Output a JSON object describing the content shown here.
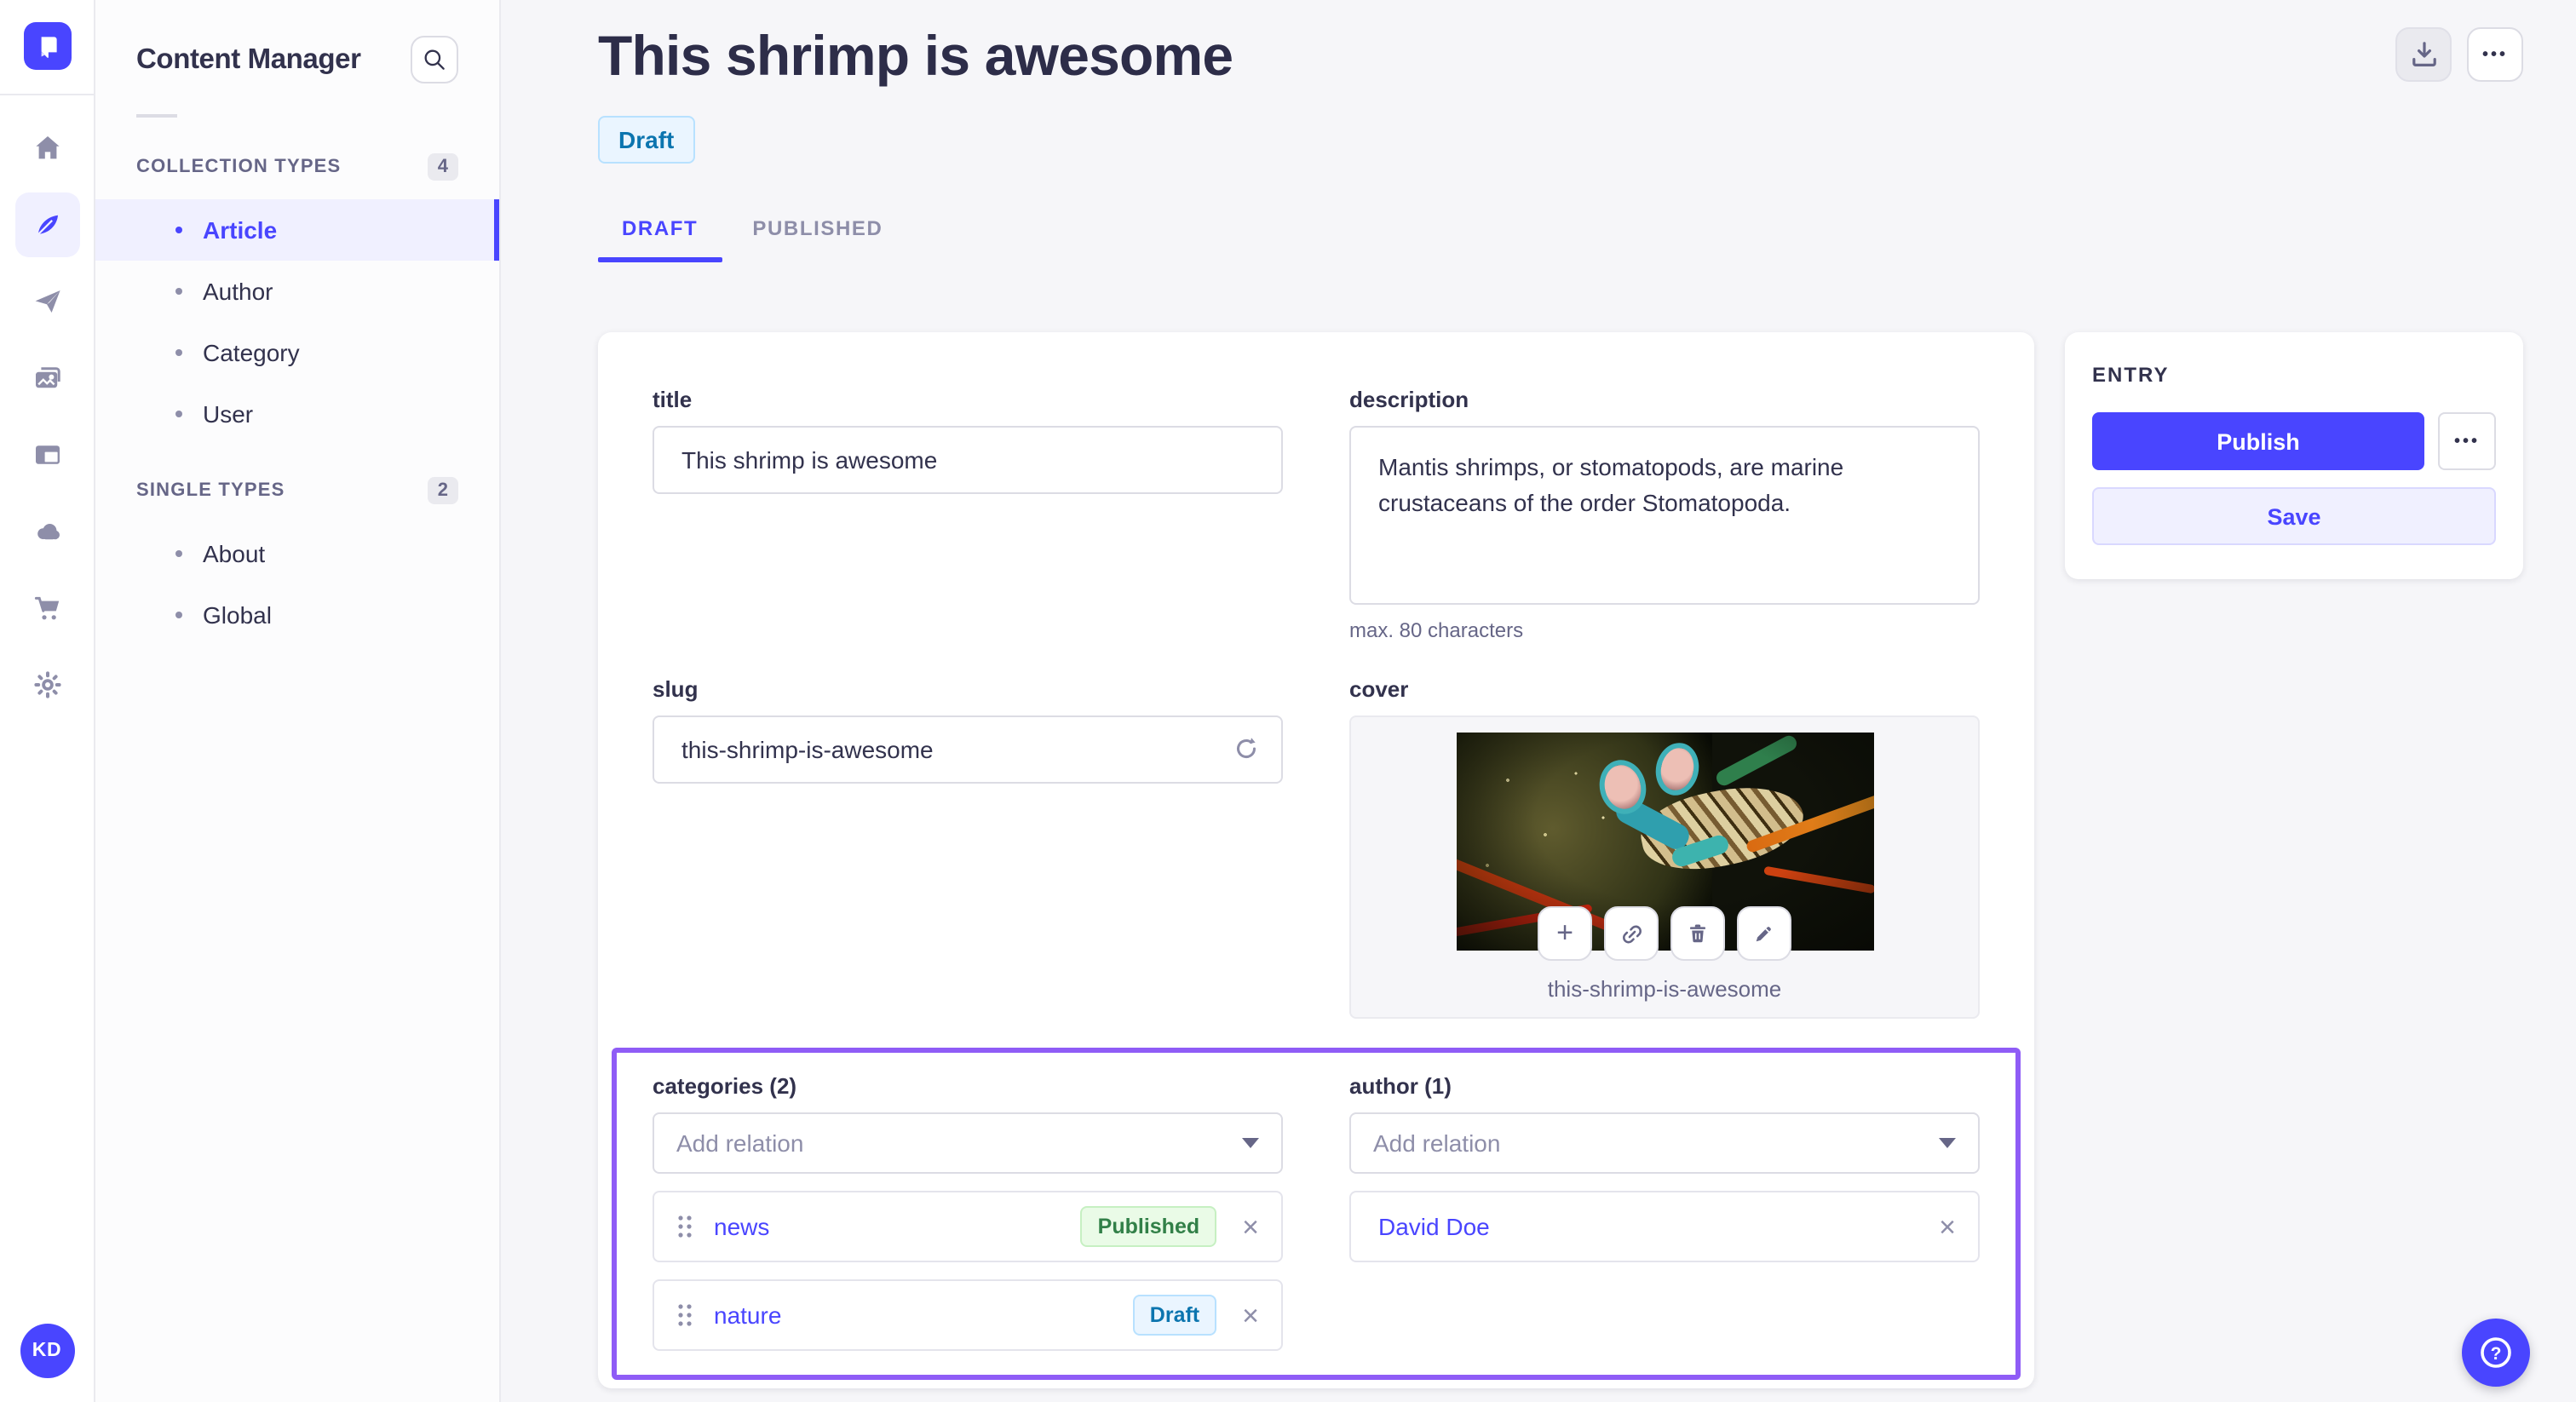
{
  "nav": {
    "avatar_initials": "KD",
    "rail_items": [
      "home",
      "content-manager",
      "releases",
      "media-library",
      "content-type-builder",
      "deploy-cloud",
      "marketplace",
      "settings"
    ],
    "active_rail_item": "content-manager"
  },
  "sidebar": {
    "title": "Content Manager",
    "search_icon": "search-icon",
    "sections": [
      {
        "label": "COLLECTION TYPES",
        "count": "4",
        "items": [
          {
            "label": "Article",
            "active": true
          },
          {
            "label": "Author",
            "active": false
          },
          {
            "label": "Category",
            "active": false
          },
          {
            "label": "User",
            "active": false
          }
        ]
      },
      {
        "label": "SINGLE TYPES",
        "count": "2",
        "items": [
          {
            "label": "About",
            "active": false
          },
          {
            "label": "Global",
            "active": false
          }
        ]
      }
    ]
  },
  "header": {
    "title": "This shrimp is awesome",
    "status_badge": "Draft",
    "actions": {
      "download_icon": "download-icon",
      "more_label": "•••"
    },
    "tabs": [
      {
        "label": "DRAFT",
        "active": true
      },
      {
        "label": "PUBLISHED",
        "active": false
      }
    ]
  },
  "form": {
    "title": {
      "label": "title",
      "value": "This shrimp is awesome"
    },
    "description": {
      "label": "description",
      "value": "Mantis shrimps, or stomatopods, are marine crustaceans of the order Stomatopoda.",
      "helper": "max. 80 characters"
    },
    "slug": {
      "label": "slug",
      "value": "this-shrimp-is-awesome",
      "regenerate_icon": "refresh-icon"
    },
    "cover": {
      "label": "cover",
      "caption": "this-shrimp-is-awesome",
      "action_icons": [
        "plus-icon",
        "link-icon",
        "trash-icon",
        "pencil-icon"
      ]
    },
    "categories": {
      "label": "categories (2)",
      "placeholder": "Add relation",
      "items": [
        {
          "name": "news",
          "status": "Published"
        },
        {
          "name": "nature",
          "status": "Draft"
        }
      ]
    },
    "author": {
      "label": "author (1)",
      "placeholder": "Add relation",
      "items": [
        {
          "name": "David Doe"
        }
      ]
    }
  },
  "entry_panel": {
    "title": "ENTRY",
    "publish_label": "Publish",
    "save_label": "Save",
    "more_label": "•••"
  },
  "misc": {
    "help_icon": "question-mark-icon",
    "plus_label": "+",
    "close_label": "×"
  },
  "colors": {
    "primary": "#4945ff",
    "primary_light_bg": "#f0f0ff",
    "modified_outline": "#8f5cf6",
    "draft_bg": "#eaf5ff",
    "draft_border": "#b8e1ff",
    "draft_text": "#0c75af",
    "published_bg": "#eafbe7",
    "published_border": "#c6f0c2",
    "published_text": "#328048",
    "page_bg": "#f6f6f9",
    "card_bg": "#ffffff",
    "border": "#dcdce4",
    "muted_text": "#666687"
  }
}
